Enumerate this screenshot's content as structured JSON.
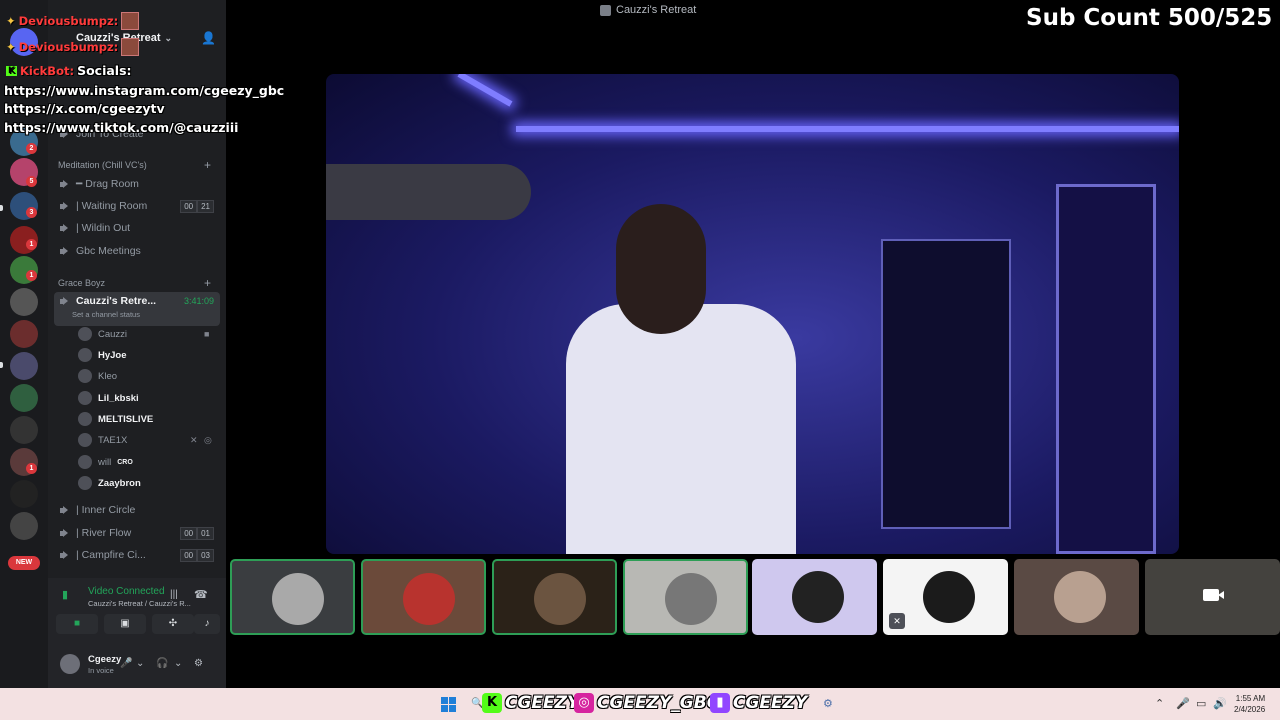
{
  "window": {
    "title": "Cauzzi's Retreat"
  },
  "overlay": {
    "sub_count": "Sub Count 500/525",
    "alerts": [
      "Deviousbumpz:",
      "Deviousbumpz:",
      "KickBot:"
    ],
    "socials_label": "Socials:",
    "socials": [
      "https://www.instagram.com/cgeezy_gbc",
      "https://x.com/cgeezytv",
      "https://www.tiktok.com/@cauzziii"
    ]
  },
  "server": {
    "name": "Cauzzi's Retreat"
  },
  "rail_badges": [
    "2",
    "5",
    "3",
    "1",
    "1",
    "1"
  ],
  "rail_new_label": "NEW",
  "sidebar": {
    "join_to_create": "Join To Create",
    "category_meditation": "Meditation (Chill VC's)",
    "channels": [
      {
        "label": "━ Drag Room"
      },
      {
        "label": "| Waiting Room",
        "counts": [
          "00",
          "21"
        ]
      },
      {
        "label": "| Wildin Out"
      },
      {
        "label": "Gbc Meetings"
      }
    ],
    "category_grace": "Grace Boyz",
    "active_channel": {
      "label": "Cauzzi's Retre...",
      "timer": "3:41:09",
      "status": "Set a channel status"
    },
    "members": [
      {
        "name": "Cauzzi"
      },
      {
        "name": "HyJoe"
      },
      {
        "name": "Kleo"
      },
      {
        "name": "Lil_kbski"
      },
      {
        "name": "MELTISLIVE"
      },
      {
        "name": "TAE1X"
      },
      {
        "name": "will",
        "tag": "CRO"
      },
      {
        "name": "Zaaybron"
      }
    ],
    "bottom_channels": [
      {
        "label": "| Inner Circle"
      },
      {
        "label": "| River Flow",
        "counts": [
          "00",
          "01"
        ]
      },
      {
        "label": "| Campfire Ci...",
        "counts": [
          "00",
          "03"
        ]
      }
    ]
  },
  "voice_panel": {
    "status": "Video Connected",
    "location": "Cauzzi's Retreat / Cauzzi's R..."
  },
  "user": {
    "name": "Cgeezy",
    "status": "In voice"
  },
  "taskbar": {
    "brands": [
      "CGEEZY",
      "CGEEZY_GBC",
      "CGEEZY"
    ],
    "time": "1:55 AM",
    "date": "2/4/2026"
  },
  "colors": {
    "accent_green": "#23a55a",
    "stage_glow": "#6a66ff",
    "danger": "#da373c"
  }
}
